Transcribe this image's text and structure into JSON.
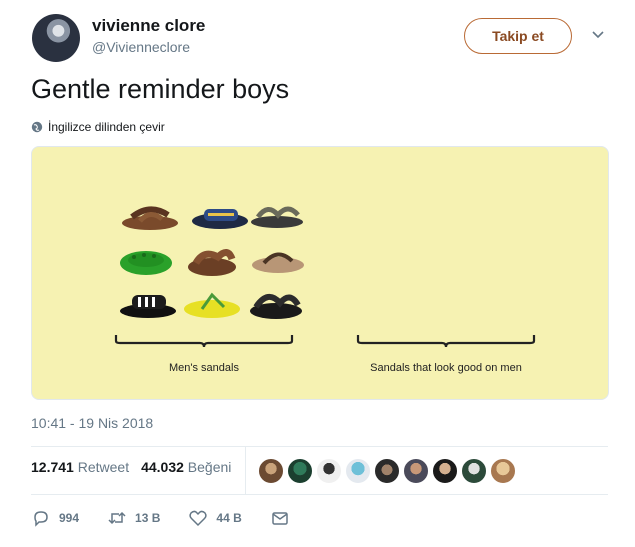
{
  "user": {
    "name": "vivienne clore",
    "handle": "@Vivienneclore",
    "follow_label": "Takip et"
  },
  "tweet": {
    "text": "Gentle reminder boys",
    "translate_label": "İngilizce dilinden çevir"
  },
  "media": {
    "caption_left": "Men's sandals",
    "caption_right": "Sandals that look good on men"
  },
  "meta": {
    "timestamp": "10:41 - 19 Nis 2018"
  },
  "stats": {
    "retweets": "12.741",
    "retweet_label": "Retweet",
    "likes": "44.032",
    "like_label": "Beğeni"
  },
  "actions": {
    "replies": "994",
    "retweets": "13 B",
    "likes": "44 B"
  },
  "icons": [
    "chevron-down-icon",
    "globe-icon",
    "reply-icon",
    "retweet-icon",
    "heart-icon",
    "mail-icon"
  ],
  "colors": {
    "follow_border": "#b96a35",
    "media_bg": "#f6f2b2",
    "muted": "#657786"
  }
}
